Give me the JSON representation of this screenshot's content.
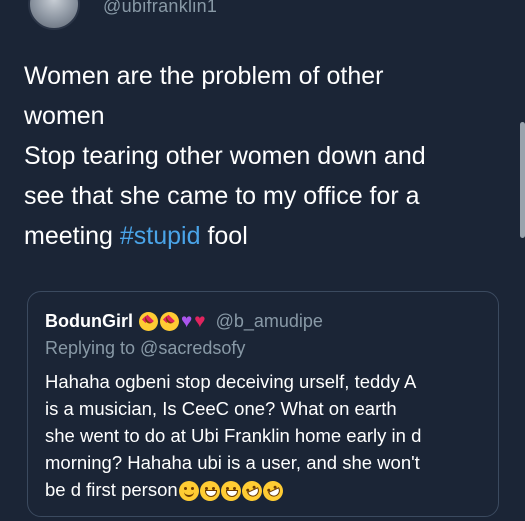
{
  "author": {
    "handle": "@ubifranklin1"
  },
  "tweet": {
    "lines": [
      "Women are the problem of other",
      "women",
      "Stop tearing other women down and",
      "see that she came to my office for a"
    ],
    "last_line_before": "meeting ",
    "hashtag": "#stupid",
    "last_line_after": " fool"
  },
  "quoted_tweet": {
    "name": "BodunGirl",
    "name_emojis": [
      "heart-eyes-face-icon",
      "heart-eyes-face-icon",
      "purple-heart-icon",
      "red-heart-icon"
    ],
    "handle": "@b_amudipe",
    "replying_to": "Replying to @sacredsofy",
    "lines": [
      "Hahaha ogbeni stop deceiving urself, teddy A",
      "is a musician, Is CeeC one? What on earth",
      "she went to do at Ubi Franklin home early in d",
      "morning? Hahaha ubi is a user, and she won't"
    ],
    "last_line": "be d first person",
    "trailing_emojis": [
      "slightly-smiling-face-icon",
      "grinning-face-icon",
      "grinning-face-icon",
      "rofl-face-icon",
      "rofl-face-icon"
    ]
  },
  "colors": {
    "background": "#1b2536",
    "hashtag": "#4aa4e8",
    "secondary_text": "#8899a6",
    "card_border": "#3b4a5f"
  }
}
